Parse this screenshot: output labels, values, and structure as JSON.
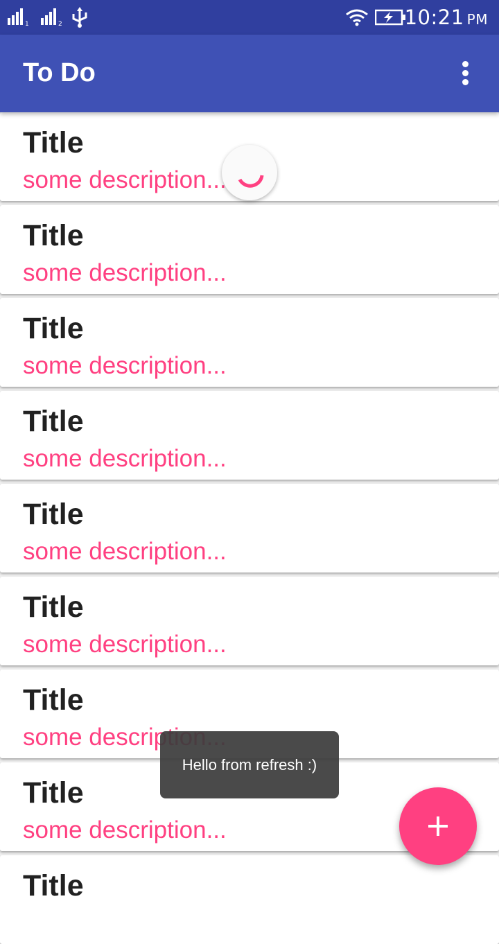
{
  "status_bar": {
    "time": "10:21",
    "ampm": "PM"
  },
  "app_bar": {
    "title": "To Do"
  },
  "cards": [
    {
      "title": "Title",
      "description": "some description..."
    },
    {
      "title": "Title",
      "description": "some description..."
    },
    {
      "title": "Title",
      "description": "some description..."
    },
    {
      "title": "Title",
      "description": "some description..."
    },
    {
      "title": "Title",
      "description": "some description..."
    },
    {
      "title": "Title",
      "description": "some description..."
    },
    {
      "title": "Title",
      "description": "some description..."
    },
    {
      "title": "Title",
      "description": "some description..."
    },
    {
      "title": "Title",
      "description": ""
    }
  ],
  "toast": {
    "message": "Hello from refresh :)"
  },
  "icons": {
    "status": [
      "signal-sim1-icon",
      "signal-sim2-icon",
      "usb-icon",
      "wifi-icon",
      "battery-charging-icon"
    ],
    "overflow": "more-vert-icon",
    "fab": "add-icon"
  },
  "colors": {
    "primary": "#3f51b5",
    "primary_dark": "#303f9f",
    "accent": "#ff4081"
  }
}
